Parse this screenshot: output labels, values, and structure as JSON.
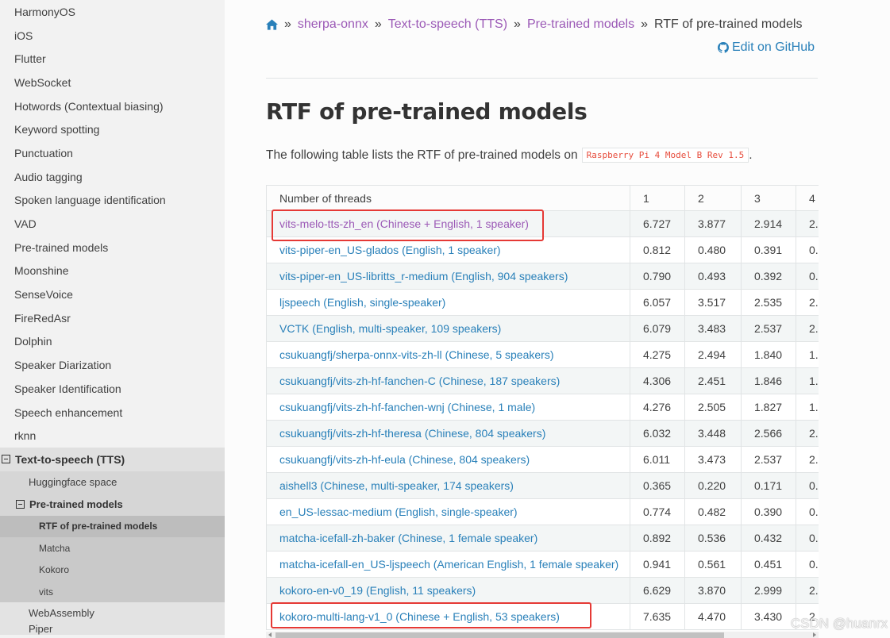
{
  "sidebar": {
    "items": [
      {
        "label": "HarmonyOS"
      },
      {
        "label": "iOS"
      },
      {
        "label": "Flutter"
      },
      {
        "label": "WebSocket"
      },
      {
        "label": "Hotwords (Contextual biasing)"
      },
      {
        "label": "Keyword spotting"
      },
      {
        "label": "Punctuation"
      },
      {
        "label": "Audio tagging"
      },
      {
        "label": "Spoken language identification"
      },
      {
        "label": "VAD"
      },
      {
        "label": "Pre-trained models"
      },
      {
        "label": "Moonshine"
      },
      {
        "label": "SenseVoice"
      },
      {
        "label": "FireRedAsr"
      },
      {
        "label": "Dolphin"
      },
      {
        "label": "Speaker Diarization"
      },
      {
        "label": "Speaker Identification"
      },
      {
        "label": "Speech enhancement"
      },
      {
        "label": "rknn"
      }
    ],
    "tts": {
      "label": "Text-to-speech (TTS)",
      "huggingface": "Huggingface space",
      "pretrained": "Pre-trained models",
      "sub": [
        "RTF of pre-trained models",
        "Matcha",
        "Kokoro",
        "vits"
      ],
      "webassembly": "WebAssembly",
      "next_partial": "Piper"
    }
  },
  "breadcrumb": {
    "items": [
      "sherpa-onnx",
      "Text-to-speech (TTS)",
      "Pre-trained models"
    ],
    "current": "RTF of pre-trained models",
    "separator": "»"
  },
  "edit_link": "Edit on GitHub",
  "page_title": "RTF of pre-trained models",
  "intro": {
    "text": "The following table lists the RTF of pre-trained models on",
    "code": "Raspberry Pi 4 Model B Rev 1.5",
    "suffix": "."
  },
  "table": {
    "headers": [
      "Number of threads",
      "1",
      "2",
      "3",
      "4"
    ],
    "rows": [
      {
        "model": "vits-melo-tts-zh_en (Chinese + English, 1 speaker)",
        "values": [
          "6.727",
          "3.877",
          "2.914",
          "2."
        ]
      },
      {
        "model": "vits-piper-en_US-glados (English, 1 speaker)",
        "values": [
          "0.812",
          "0.480",
          "0.391",
          "0."
        ]
      },
      {
        "model": "vits-piper-en_US-libritts_r-medium (English, 904 speakers)",
        "values": [
          "0.790",
          "0.493",
          "0.392",
          "0."
        ]
      },
      {
        "model": "ljspeech (English, single-speaker)",
        "values": [
          "6.057",
          "3.517",
          "2.535",
          "2."
        ]
      },
      {
        "model": "VCTK (English, multi-speaker, 109 speakers)",
        "values": [
          "6.079",
          "3.483",
          "2.537",
          "2."
        ]
      },
      {
        "model": "csukuangfj/sherpa-onnx-vits-zh-ll (Chinese, 5 speakers)",
        "values": [
          "4.275",
          "2.494",
          "1.840",
          "1."
        ]
      },
      {
        "model": "csukuangfj/vits-zh-hf-fanchen-C (Chinese, 187 speakers)",
        "values": [
          "4.306",
          "2.451",
          "1.846",
          "1."
        ]
      },
      {
        "model": "csukuangfj/vits-zh-hf-fanchen-wnj (Chinese, 1 male)",
        "values": [
          "4.276",
          "2.505",
          "1.827",
          "1."
        ]
      },
      {
        "model": "csukuangfj/vits-zh-hf-theresa (Chinese, 804 speakers)",
        "values": [
          "6.032",
          "3.448",
          "2.566",
          "2."
        ]
      },
      {
        "model": "csukuangfj/vits-zh-hf-eula (Chinese, 804 speakers)",
        "values": [
          "6.011",
          "3.473",
          "2.537",
          "2."
        ]
      },
      {
        "model": "aishell3 (Chinese, multi-speaker, 174 speakers)",
        "values": [
          "0.365",
          "0.220",
          "0.171",
          "0."
        ]
      },
      {
        "model": "en_US-lessac-medium (English, single-speaker)",
        "values": [
          "0.774",
          "0.482",
          "0.390",
          "0."
        ]
      },
      {
        "model": "matcha-icefall-zh-baker (Chinese, 1 female speaker)",
        "values": [
          "0.892",
          "0.536",
          "0.432",
          "0."
        ]
      },
      {
        "model": "matcha-icefall-en_US-ljspeech (American English, 1 female speaker)",
        "values": [
          "0.941",
          "0.561",
          "0.451",
          "0."
        ]
      },
      {
        "model": "kokoro-en-v0_19 (English, 11 speakers)",
        "values": [
          "6.629",
          "3.870",
          "2.999",
          "2."
        ]
      },
      {
        "model": "kokoro-multi-lang-v1_0 (Chinese + English, 53 speakers)",
        "values": [
          "7.635",
          "4.470",
          "3.430",
          "2."
        ]
      }
    ]
  },
  "watermark": "CSDN @huanrx",
  "colors": {
    "link": "#2980b9",
    "visited": "#9b59b6",
    "code": "#e74c3c",
    "highlight": "#e53935"
  }
}
